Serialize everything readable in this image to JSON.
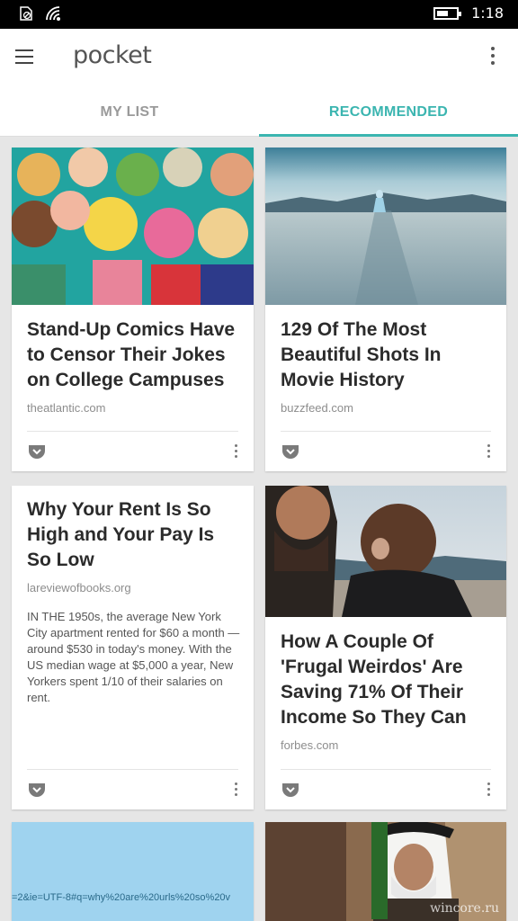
{
  "status_bar": {
    "time": "1:18",
    "battery_level": 0.6
  },
  "app_bar": {
    "logo": "pocket"
  },
  "tabs": [
    {
      "label": "MY LIST",
      "active": false
    },
    {
      "label": "RECOMMENDED",
      "active": true
    }
  ],
  "accent_color": "#3bb5b0",
  "cards": [
    {
      "title": "Stand-Up Comics Have to Censor Their Jokes on College Campuses",
      "source": "theatlantic.com",
      "image": "comic-crowd-illustration"
    },
    {
      "title": "129 Of The Most Beautiful Shots In Movie History",
      "source": "buzzfeed.com",
      "image": "salt-flat-figure-photo"
    },
    {
      "title": "Why Your Rent Is So High and Your Pay Is So Low",
      "source": "lareviewofbooks.org",
      "excerpt": "IN THE 1950s, the average New York City apartment rented for $60 a month — around $530 in today's money. With the US median wage at $5,000 a year, New Yorkers spent 1/10 of their salaries on rent."
    },
    {
      "title": "How A Couple Of 'Frugal Weirdos' Are Saving 71% Of Their Income So They Can",
      "source": "forbes.com",
      "image": "couple-mountain-photo"
    },
    {
      "image": "url-screenshot",
      "image_text": "=2&ie=UTF-8#q=why%20are%20urls%20so%20v"
    },
    {
      "image": "king-portrait-photo",
      "watermark": "wincore.ru"
    }
  ]
}
